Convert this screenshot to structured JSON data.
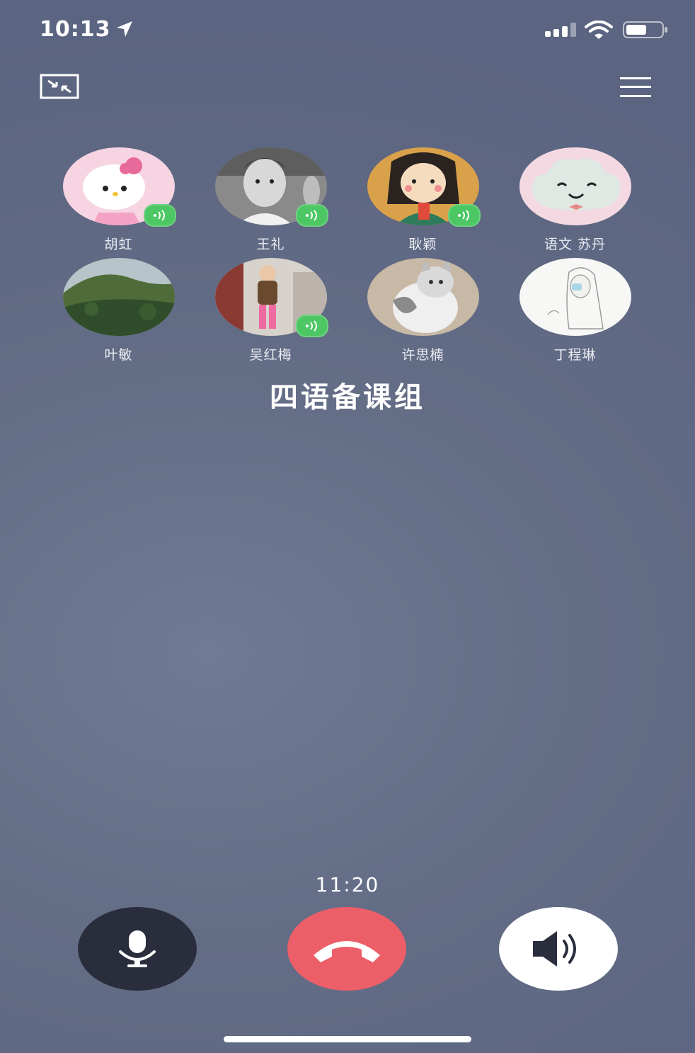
{
  "status_bar": {
    "time": "10:13",
    "icons": [
      "location-arrow-icon",
      "cellular-signal-icon",
      "wifi-icon",
      "battery-icon"
    ]
  },
  "toolbar": {
    "minimize_icon": "minimize-window-icon",
    "menu_icon": "hamburger-menu-icon"
  },
  "participants": [
    {
      "name": "胡虹",
      "avatar": "hello-kitty",
      "speaking": true
    },
    {
      "name": "王礼",
      "avatar": "bw-child-photo",
      "speaking": true
    },
    {
      "name": "耿颖",
      "avatar": "girl-illustration",
      "speaking": true
    },
    {
      "name": "语文  苏丹",
      "avatar": "smiling-cloud",
      "speaking": false
    },
    {
      "name": "叶敏",
      "avatar": "mountain-landscape",
      "speaking": false
    },
    {
      "name": "吴红梅",
      "avatar": "child-photo",
      "speaking": true
    },
    {
      "name": "许思楠",
      "avatar": "cat-photo",
      "speaking": false
    },
    {
      "name": "丁程琳",
      "avatar": "girl-sketch",
      "speaking": false
    }
  ],
  "call": {
    "group_name": "四语备课组",
    "duration": "11:20"
  },
  "controls": {
    "mic_icon": "microphone-icon",
    "hangup_icon": "hang-up-phone-icon",
    "speaker_icon": "speaker-icon"
  },
  "colors": {
    "background": "#646d86",
    "hangup": "#ec5e68",
    "mic_button": "#2a2d3b",
    "speaking_badge": "#4cc764"
  }
}
